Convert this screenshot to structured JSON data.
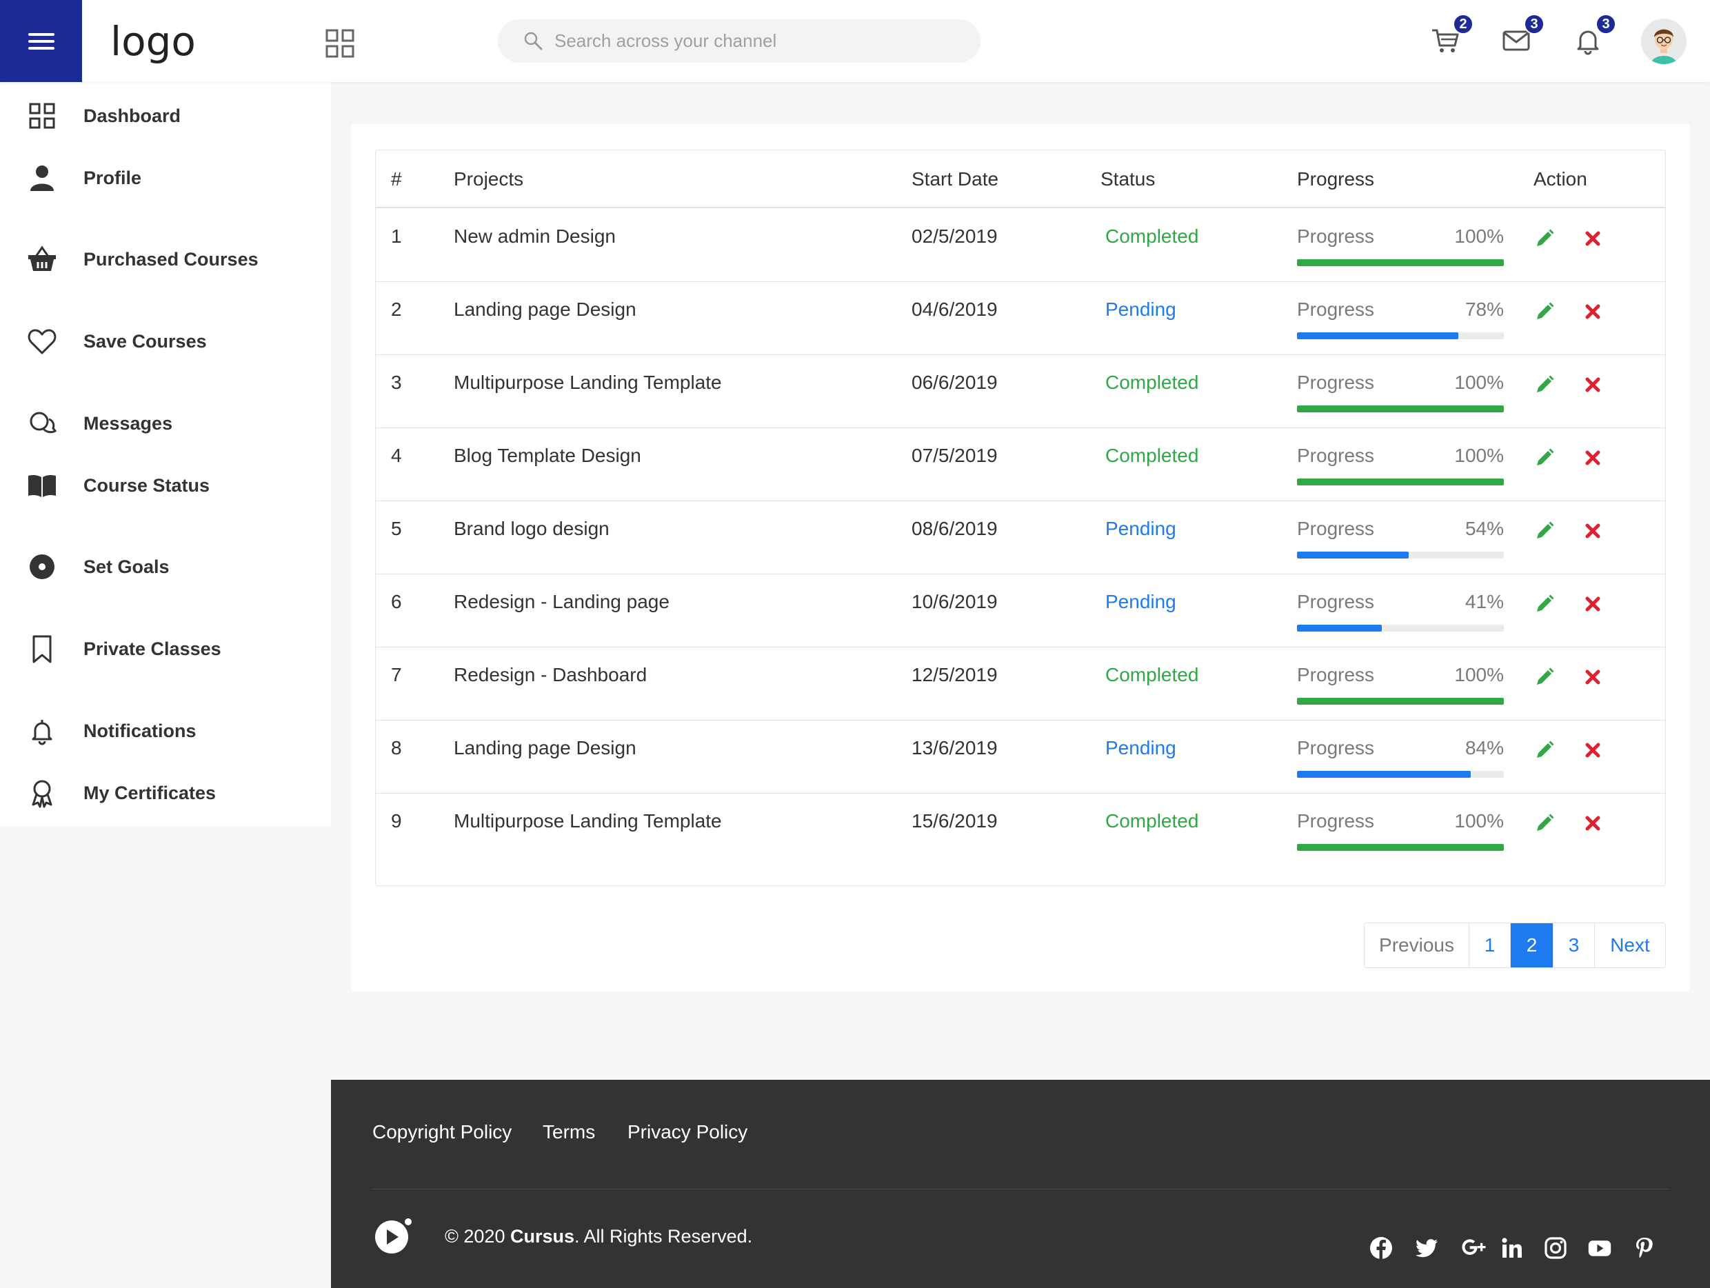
{
  "header": {
    "logo": "logo",
    "search_placeholder": "Search across your channel",
    "cart_count": "2",
    "messages_count": "3",
    "notifications_count": "3"
  },
  "sidebar": {
    "items": [
      {
        "label": "Dashboard",
        "icon": "dashboard-icon"
      },
      {
        "label": "Profile",
        "icon": "user-icon"
      },
      {
        "label": "Purchased Courses",
        "icon": "basket-icon"
      },
      {
        "label": "Save Courses",
        "icon": "heart-icon"
      },
      {
        "label": "Messages",
        "icon": "chat-icon"
      },
      {
        "label": "Course Status",
        "icon": "book-icon"
      },
      {
        "label": "Set Goals",
        "icon": "target-icon"
      },
      {
        "label": "Private Classes",
        "icon": "bookmark-icon"
      },
      {
        "label": "Notifications",
        "icon": "bell-icon"
      },
      {
        "label": "My Certificates",
        "icon": "award-icon"
      }
    ]
  },
  "table": {
    "headers": [
      "#",
      "Projects",
      "Start Date",
      "Status",
      "Progress",
      "Action"
    ],
    "rows": [
      {
        "num": "1",
        "project": "New admin Design",
        "date": "02/5/2019",
        "status": "Completed",
        "progress_label": "Progress",
        "pct": "100%",
        "value": 100
      },
      {
        "num": "2",
        "project": "Landing page Design",
        "date": "04/6/2019",
        "status": "Pending",
        "progress_label": "Progress",
        "pct": "78%",
        "value": 78
      },
      {
        "num": "3",
        "project": "Multipurpose Landing Template",
        "date": "06/6/2019",
        "status": "Completed",
        "progress_label": "Progress",
        "pct": "100%",
        "value": 100
      },
      {
        "num": "4",
        "project": "Blog Template Design",
        "date": "07/5/2019",
        "status": "Completed",
        "progress_label": "Progress",
        "pct": "100%",
        "value": 100
      },
      {
        "num": "5",
        "project": "Brand logo design",
        "date": "08/6/2019",
        "status": "Pending",
        "progress_label": "Progress",
        "pct": "54%",
        "value": 54
      },
      {
        "num": "6",
        "project": "Redesign - Landing page",
        "date": "10/6/2019",
        "status": "Pending",
        "progress_label": "Progress",
        "pct": "41%",
        "value": 41
      },
      {
        "num": "7",
        "project": "Redesign - Dashboard",
        "date": "12/5/2019",
        "status": "Completed",
        "progress_label": "Progress",
        "pct": "100%",
        "value": 100
      },
      {
        "num": "8",
        "project": "Landing page Design",
        "date": "13/6/2019",
        "status": "Pending",
        "progress_label": "Progress",
        "pct": "84%",
        "value": 84
      },
      {
        "num": "9",
        "project": "Multipurpose Landing Template",
        "date": "15/6/2019",
        "status": "Completed",
        "progress_label": "Progress",
        "pct": "100%",
        "value": 100
      }
    ]
  },
  "pagination": {
    "previous": "Previous",
    "pages": [
      "1",
      "2",
      "3"
    ],
    "active_page": "2",
    "next": "Next"
  },
  "footer": {
    "links": [
      "Copyright Policy",
      "Terms",
      "Privacy Policy"
    ],
    "copyright_prefix": "© 2020 ",
    "brand": "Cursus",
    "copyright_suffix": ". All Rights Reserved.",
    "social": [
      "facebook-icon",
      "twitter-icon",
      "google-plus-icon",
      "linkedin-icon",
      "instagram-icon",
      "youtube-icon",
      "pinterest-icon"
    ]
  },
  "colors": {
    "brand": "#1b2a96",
    "completed": "#2fa845",
    "pending": "#1e7bef",
    "delete": "#e0202e",
    "footer_bg": "#333333"
  }
}
